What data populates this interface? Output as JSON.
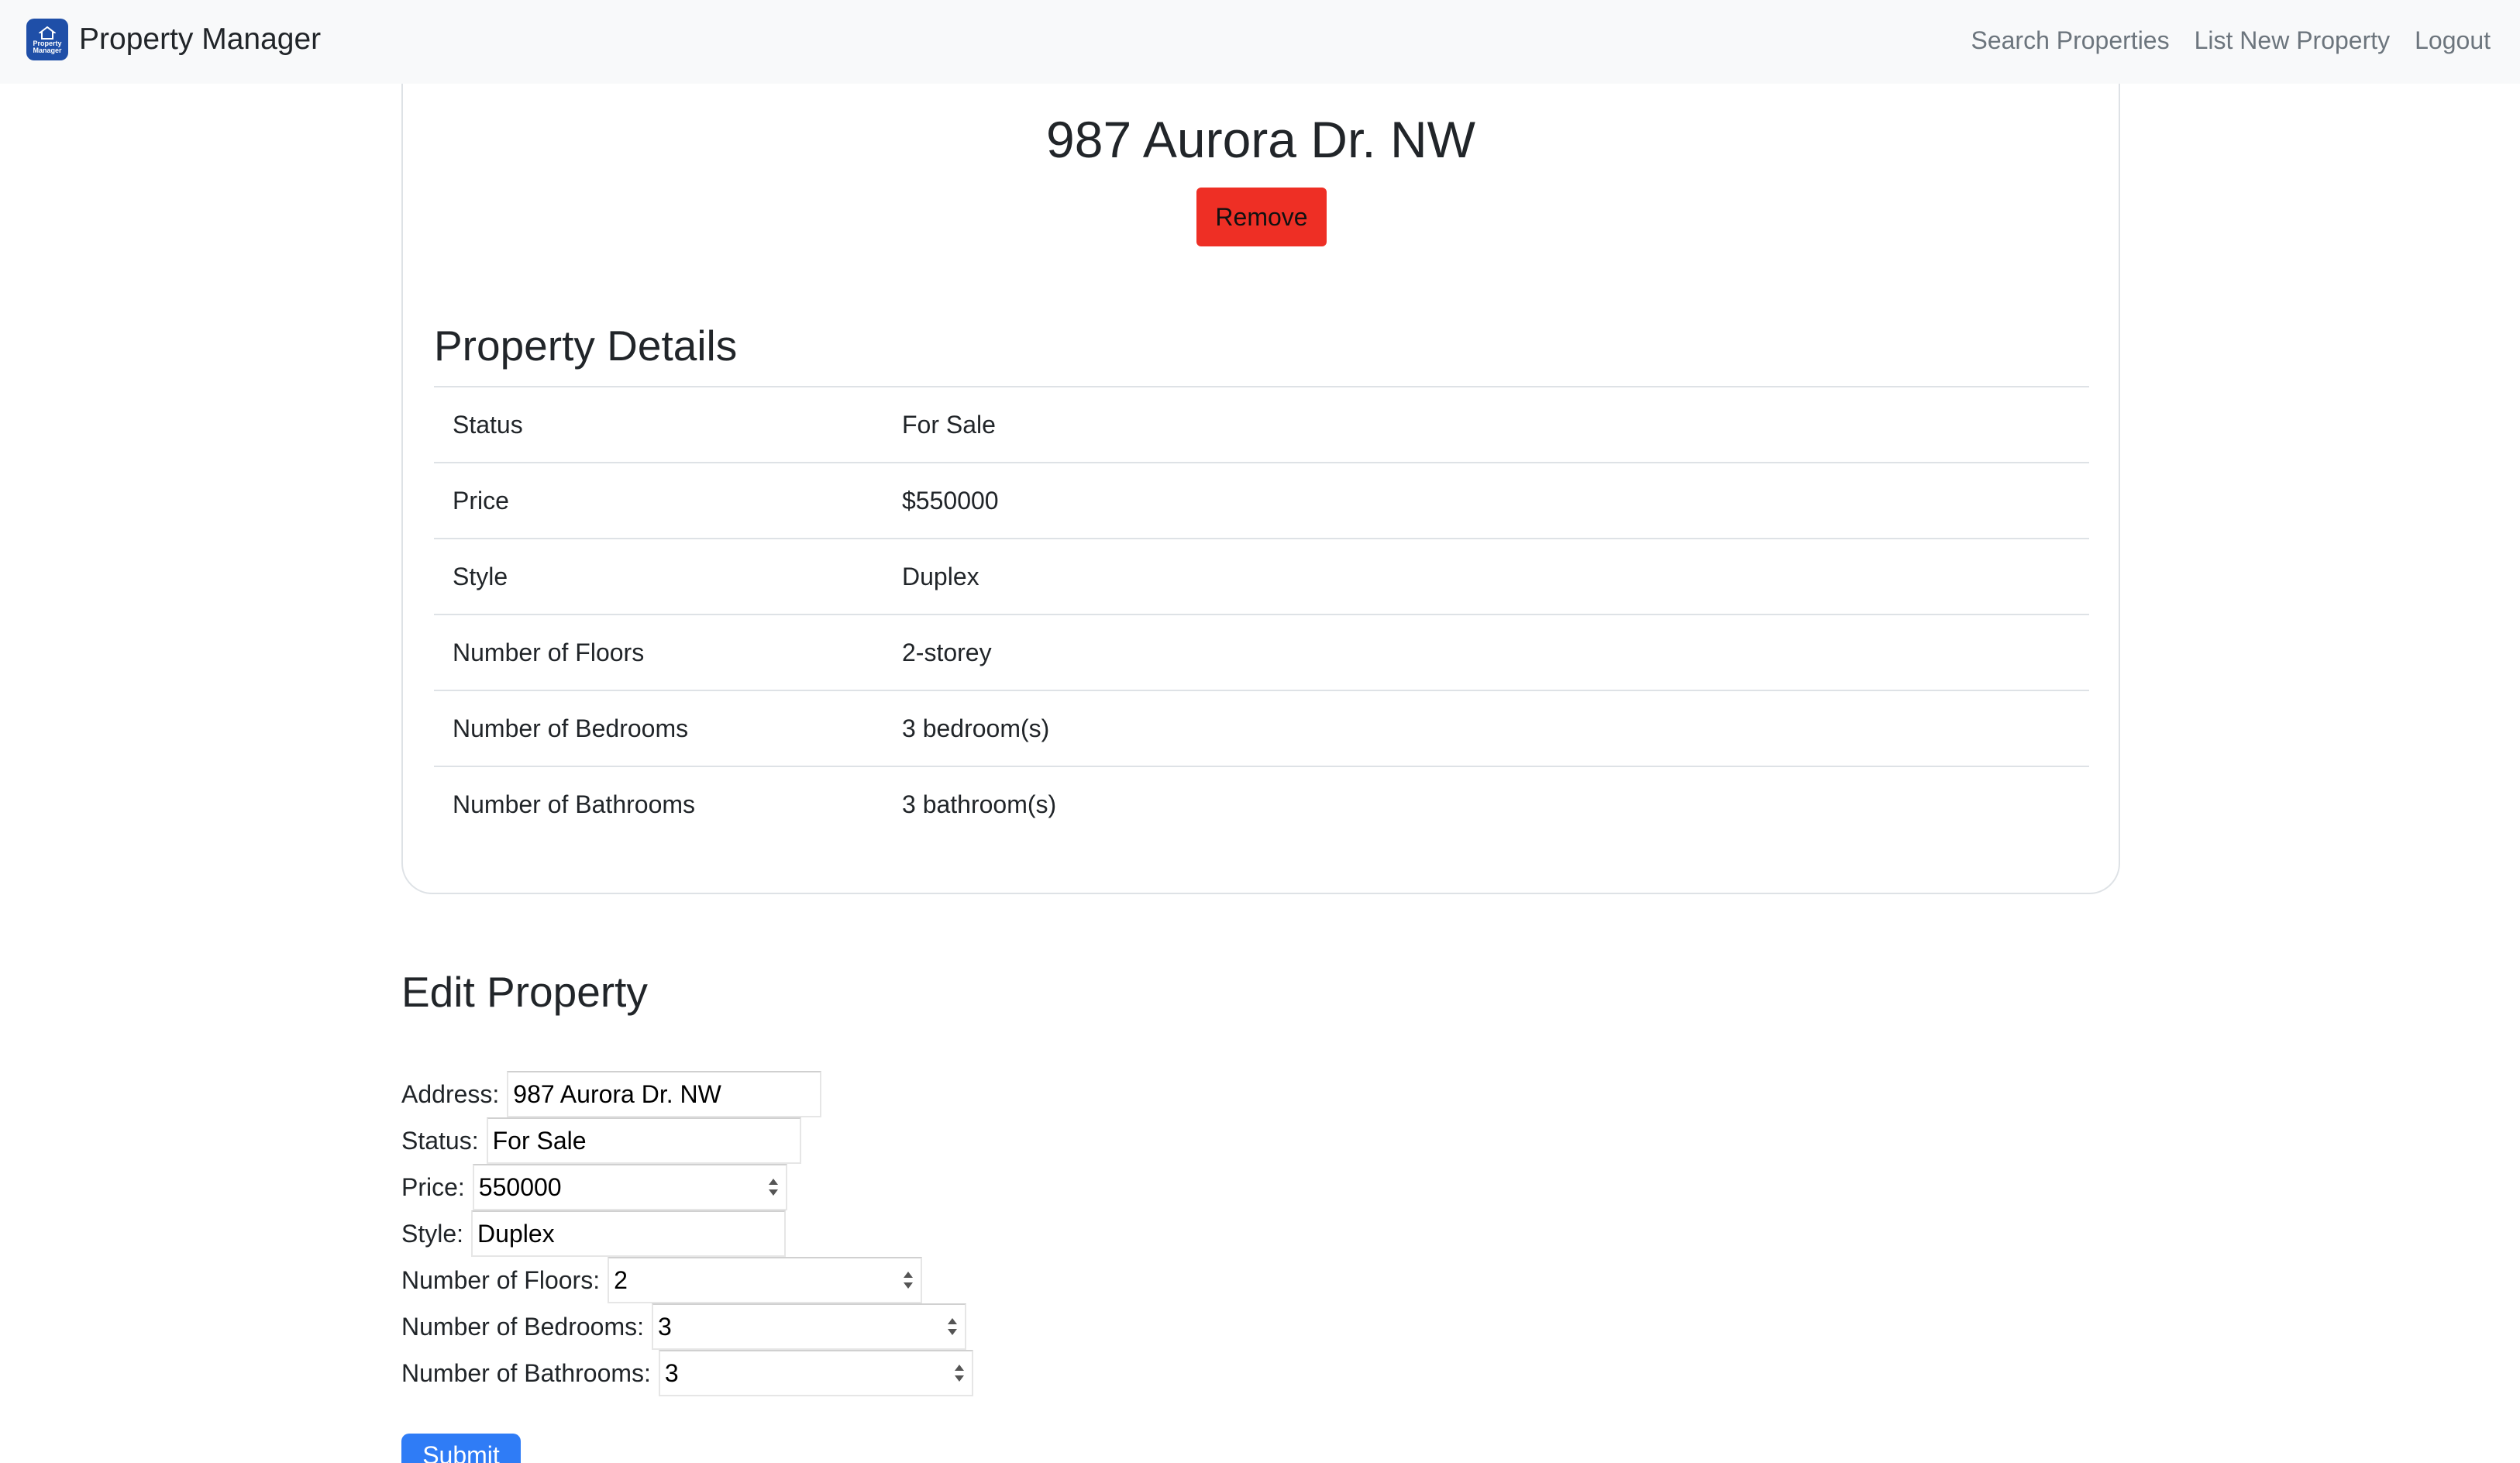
{
  "navbar": {
    "brand": "Property Manager",
    "logo_text_line1": "Property",
    "logo_text_line2": "Manager",
    "links": [
      "Search Properties",
      "List New Property",
      "Logout"
    ]
  },
  "property": {
    "title": "987 Aurora Dr. NW",
    "remove_label": "Remove"
  },
  "details": {
    "heading": "Property Details",
    "rows": [
      {
        "label": "Status",
        "value": "For Sale"
      },
      {
        "label": "Price",
        "value": "$550000"
      },
      {
        "label": "Style",
        "value": "Duplex"
      },
      {
        "label": "Number of Floors",
        "value": "2-storey"
      },
      {
        "label": "Number of Bedrooms",
        "value": "3 bedroom(s)"
      },
      {
        "label": "Number of Bathrooms",
        "value": "3 bathroom(s)"
      }
    ]
  },
  "edit": {
    "heading": "Edit Property",
    "fields": [
      {
        "label": "Address:",
        "value": "987 Aurora Dr. NW"
      },
      {
        "label": "Status:",
        "value": "For Sale"
      },
      {
        "label": "Price:",
        "value": "550000"
      },
      {
        "label": "Style:",
        "value": "Duplex"
      },
      {
        "label": "Number of Floors:",
        "value": "2"
      },
      {
        "label": "Number of Bedrooms:",
        "value": "3"
      },
      {
        "label": "Number of Bathrooms:",
        "value": "3"
      }
    ],
    "submit_label": "Submit"
  },
  "colors": {
    "remove_button": "#ee2f25",
    "submit_button": "#2f7cf6",
    "logo_background": "#1f4fa8"
  }
}
